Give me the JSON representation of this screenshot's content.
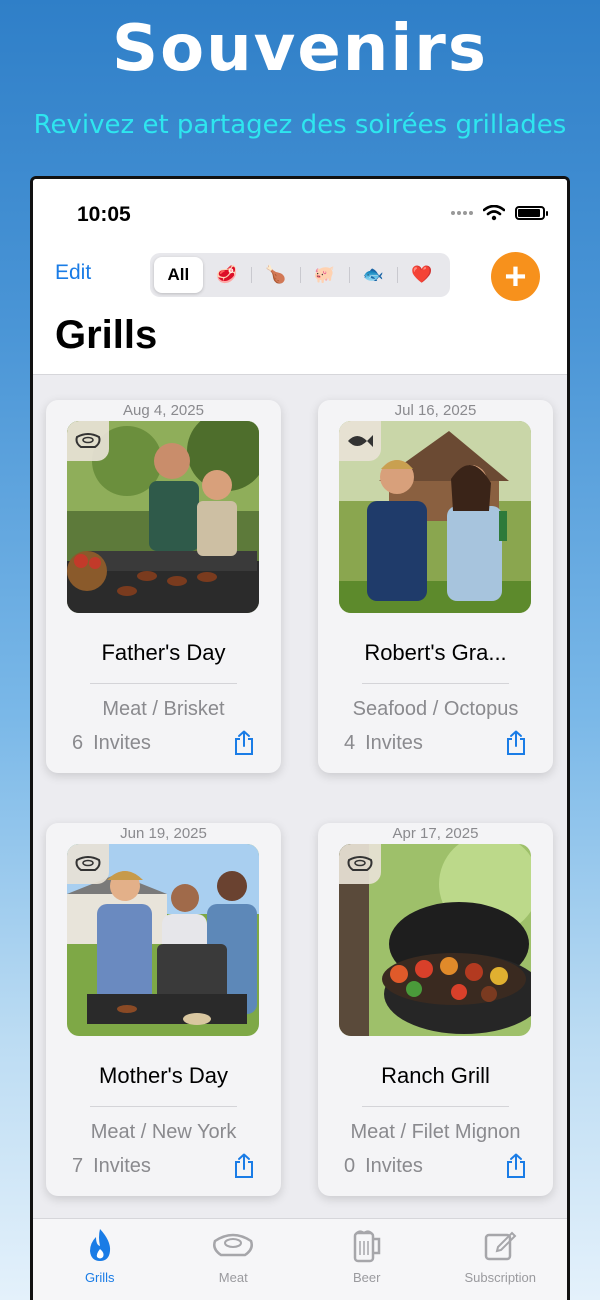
{
  "hero": {
    "title": "Souvenirs",
    "subtitle": "Revivez et partagez des soirées grillades"
  },
  "status_bar": {
    "time": "10:05"
  },
  "nav": {
    "edit_label": "Edit",
    "filters": [
      {
        "label": "All",
        "icon": "all-filter",
        "selected": true
      },
      {
        "label": "🥩",
        "icon": "steak-icon",
        "selected": false
      },
      {
        "label": "🍗",
        "icon": "drumstick-icon",
        "selected": false
      },
      {
        "label": "🐖",
        "icon": "pig-icon",
        "selected": false
      },
      {
        "label": "🐟",
        "icon": "fish-icon",
        "selected": false
      },
      {
        "label": "❤️",
        "icon": "heart-icon",
        "selected": false
      }
    ],
    "add_label": "+",
    "title": "Grills"
  },
  "grills": [
    {
      "date": "Aug 4, 2025",
      "title": "Father's Day",
      "meta": "Meat / Brisket",
      "invites_count": "6",
      "invites_label": "Invites",
      "badge_icon": "steak-outline-icon"
    },
    {
      "date": "Jul 16, 2025",
      "title": "Robert's Gra...",
      "meta": "Seafood / Octopus",
      "invites_count": "4",
      "invites_label": "Invites",
      "badge_icon": "fish-outline-icon"
    },
    {
      "date": "Jun 19, 2025",
      "title": "Mother's Day",
      "meta": "Meat / New York",
      "invites_count": "7",
      "invites_label": "Invites",
      "badge_icon": "steak-outline-icon"
    },
    {
      "date": "Apr 17, 2025",
      "title": "Ranch Grill",
      "meta": "Meat / Filet Mignon",
      "invites_count": "0",
      "invites_label": "Invites",
      "badge_icon": "steak-outline-icon"
    }
  ],
  "tabbar": {
    "items": [
      {
        "label": "Grills",
        "icon": "flame-icon",
        "active": true
      },
      {
        "label": "Meat",
        "icon": "steak-icon",
        "active": false
      },
      {
        "label": "Beer",
        "icon": "beer-mug-icon",
        "active": false
      },
      {
        "label": "Subscription",
        "icon": "compose-icon",
        "active": false
      }
    ]
  },
  "colors": {
    "accent_blue": "#1a7ce6",
    "add_orange": "#f7911c",
    "subtitle_cyan": "#2ee6ef"
  }
}
